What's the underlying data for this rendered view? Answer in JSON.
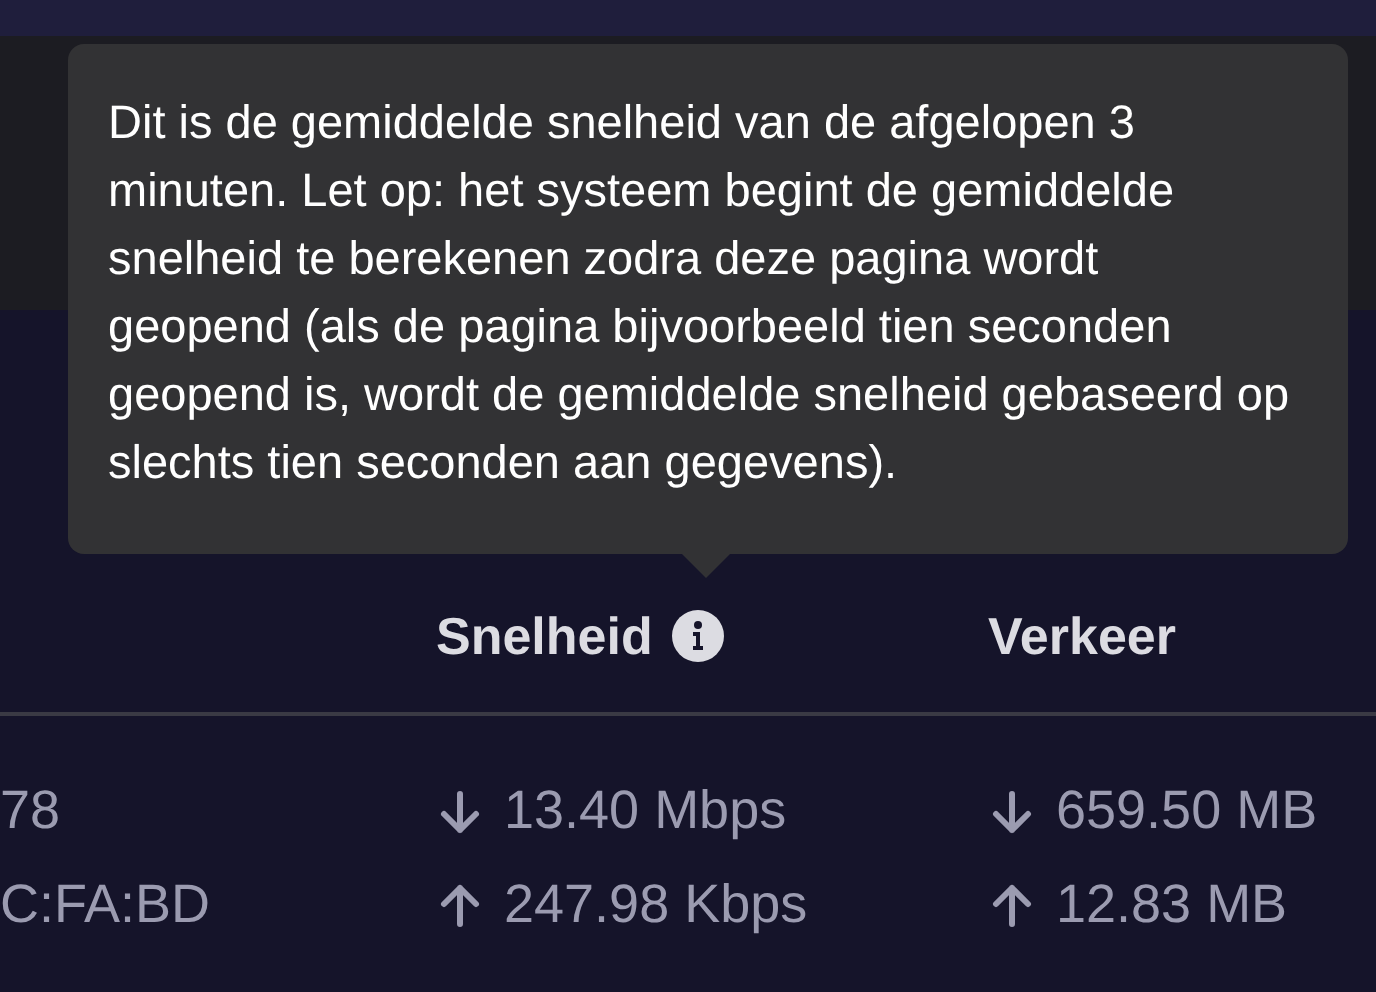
{
  "tooltip": {
    "text": "Dit is de gemiddelde snelheid van de afgelopen 3 minuten. Let op: het systeem begint de gemiddelde snelheid te berekenen zodra deze pagina wordt geopend (als de pagina bijvoorbeeld tien seconden geopend is, wordt de gemiddelde snelheid gebaseerd op slechts tien seconden aan gegevens)."
  },
  "table": {
    "columns": [
      {
        "label": "Snelheid",
        "info": true
      },
      {
        "label": "Verkeer",
        "info": false
      }
    ],
    "rows": [
      {
        "column_1": "78",
        "speed": {
          "kind": "down",
          "text": "13.40 Mbps"
        },
        "traffic": {
          "kind": "down",
          "text": "659.50 MB"
        }
      },
      {
        "column_1": "C:FA:BD",
        "speed": {
          "kind": "up",
          "text": "247.98 Kbps"
        },
        "traffic": {
          "kind": "up",
          "text": "12.83 MB"
        }
      }
    ]
  }
}
